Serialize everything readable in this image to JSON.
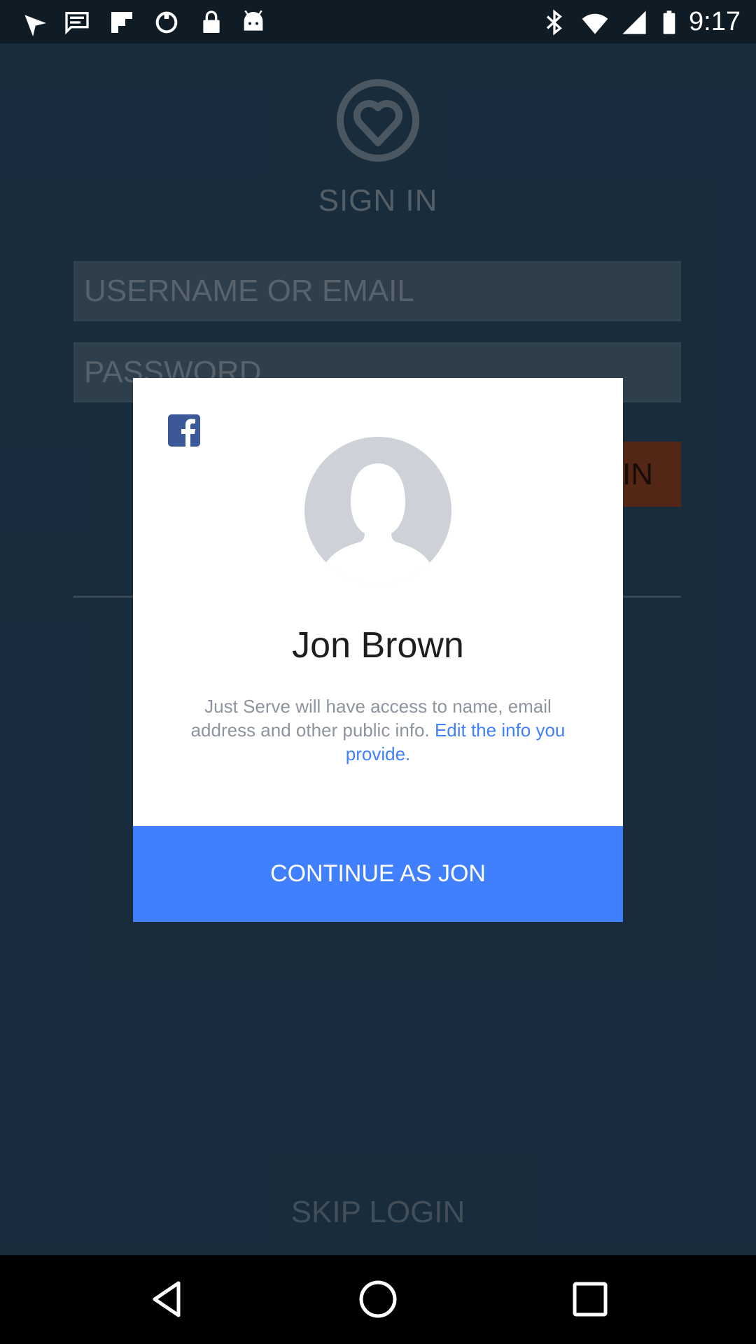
{
  "status_bar": {
    "time": "9:17",
    "icons": [
      "navigation-icon",
      "message-icon",
      "flipboard-icon",
      "sync-icon",
      "lock-icon",
      "android-icon",
      "bluetooth-icon",
      "wifi-icon",
      "signal-icon",
      "battery-icon"
    ]
  },
  "background_page": {
    "logo_icon": "heart-logo-icon",
    "title": "SIGN IN",
    "username_placeholder": "USERNAME OR EMAIL",
    "password_placeholder": "PASSWORD",
    "login_button_label": "IN",
    "skip_login_label": "SKIP LOGIN"
  },
  "dialog": {
    "brand_icon": "facebook-icon",
    "avatar_icon": "profile-silhouette-icon",
    "user_name": "Jon Brown",
    "permission_text": "Just Serve will have access to name, email address and other public info.",
    "edit_link_text": "Edit the info you provide.",
    "continue_label": "CONTINUE AS JON"
  },
  "nav_bar": {
    "back_icon": "back-icon",
    "home_icon": "home-icon",
    "recents_icon": "recents-icon"
  },
  "colors": {
    "accent_blue": "#4080ff",
    "background_page": "#2e5574",
    "login_orange": "#a04a29"
  }
}
